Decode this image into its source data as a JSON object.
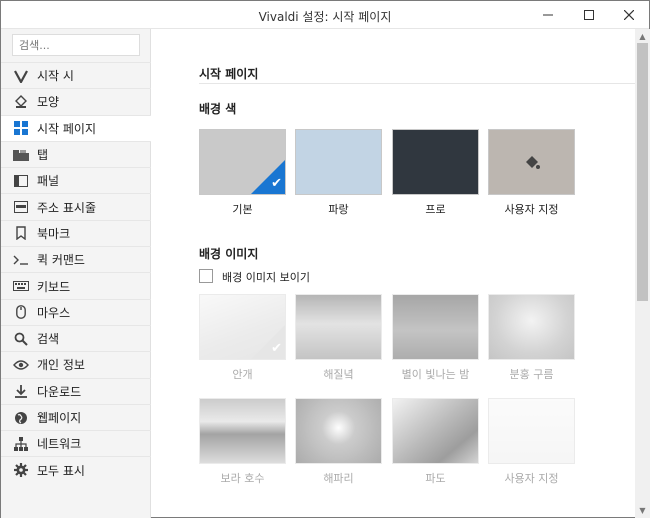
{
  "window": {
    "title": "Vivaldi 설정: 시작 페이지",
    "min_glyph": "—",
    "max_glyph": "☐",
    "close_glyph": "✕"
  },
  "sidebar": {
    "search_placeholder": "검색...",
    "active_index": 2,
    "items": [
      {
        "label": "시작 시",
        "icon": "vivaldi-logo-icon"
      },
      {
        "label": "모양",
        "icon": "paint-bucket-icon"
      },
      {
        "label": "시작 페이지",
        "icon": "windows-grid-icon"
      },
      {
        "label": "탭",
        "icon": "tabs-icon"
      },
      {
        "label": "패널",
        "icon": "panel-icon"
      },
      {
        "label": "주소 표시줄",
        "icon": "address-bar-icon"
      },
      {
        "label": "북마크",
        "icon": "bookmark-icon"
      },
      {
        "label": "퀵 커맨드",
        "icon": "quick-command-icon"
      },
      {
        "label": "키보드",
        "icon": "keyboard-icon"
      },
      {
        "label": "마우스",
        "icon": "mouse-icon"
      },
      {
        "label": "검색",
        "icon": "search-icon"
      },
      {
        "label": "개인 정보",
        "icon": "eye-icon"
      },
      {
        "label": "다운로드",
        "icon": "download-icon"
      },
      {
        "label": "웹페이지",
        "icon": "globe-icon"
      },
      {
        "label": "네트워크",
        "icon": "network-icon"
      },
      {
        "label": "모두 표시",
        "icon": "gear-icon"
      }
    ]
  },
  "content": {
    "section_title": "시작 페이지",
    "bg_color_title": "배경 색",
    "bg_colors": [
      {
        "label": "기본",
        "color": "#c9c9c9",
        "selected": true
      },
      {
        "label": "파랑",
        "color": "#c2d4e4",
        "selected": false
      },
      {
        "label": "프로",
        "color": "#30373f",
        "selected": false
      },
      {
        "label": "사용자 지정",
        "color": "#bcb6b0",
        "selected": false
      }
    ],
    "bg_image_title": "배경 이미지",
    "show_bg_image_label": "배경 이미지 보이기",
    "show_bg_image_checked": false,
    "bg_images_row1": [
      {
        "label": "안개"
      },
      {
        "label": "해질녘"
      },
      {
        "label": "별이 빛나는 밤"
      },
      {
        "label": "분홍 구름"
      }
    ],
    "bg_images_row2": [
      {
        "label": "보라 호수"
      },
      {
        "label": "해파리"
      },
      {
        "label": "파도"
      },
      {
        "label": "사용자 지정"
      }
    ]
  },
  "colors": {
    "accent": "#1976d2"
  }
}
